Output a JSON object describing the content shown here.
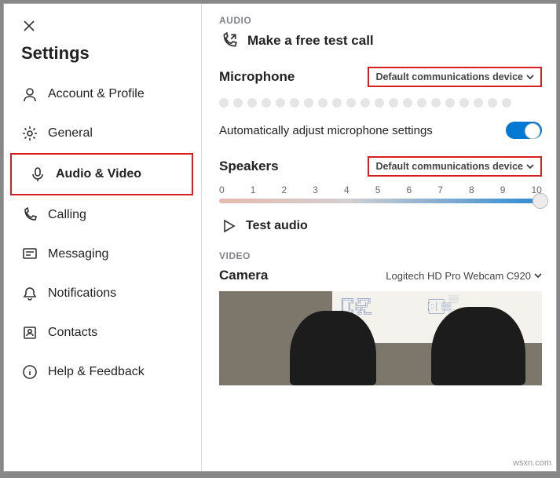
{
  "sidebar": {
    "title": "Settings",
    "items": [
      {
        "label": "Account & Profile"
      },
      {
        "label": "General"
      },
      {
        "label": "Audio & Video"
      },
      {
        "label": "Calling"
      },
      {
        "label": "Messaging"
      },
      {
        "label": "Notifications"
      },
      {
        "label": "Contacts"
      },
      {
        "label": "Help & Feedback"
      }
    ]
  },
  "audio": {
    "section": "AUDIO",
    "test_call": "Make a free test call",
    "microphone_label": "Microphone",
    "microphone_device": "Default communications device",
    "auto_adjust": "Automatically adjust microphone settings",
    "speakers_label": "Speakers",
    "speakers_device": "Default communications device",
    "scale": [
      "0",
      "1",
      "2",
      "3",
      "4",
      "5",
      "6",
      "7",
      "8",
      "9",
      "10"
    ],
    "test_audio": "Test audio"
  },
  "video": {
    "section": "VIDEO",
    "camera_label": "Camera",
    "camera_device": "Logitech HD Pro Webcam C920"
  },
  "watermark": "wsxn.com"
}
